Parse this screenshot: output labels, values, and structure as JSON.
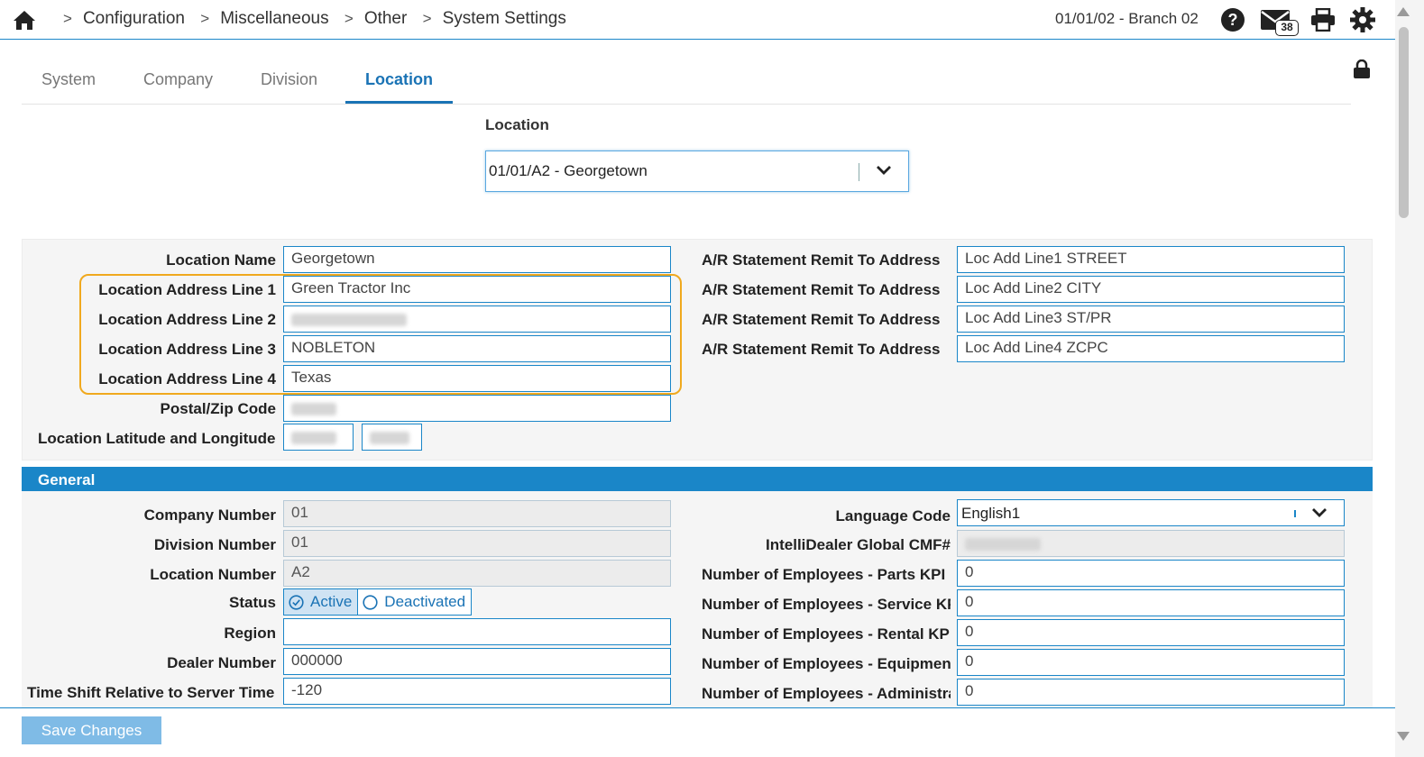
{
  "header": {
    "breadcrumbs": [
      "Configuration",
      "Miscellaneous",
      "Other",
      "System Settings"
    ],
    "breadcrumb_separator": ">",
    "branch": "01/01/02 - Branch 02",
    "mail_count": "38",
    "icons": [
      "home-icon",
      "help-icon",
      "mail-icon",
      "print-icon",
      "gear-icon"
    ]
  },
  "tabs": [
    {
      "label": "System",
      "active": false
    },
    {
      "label": "Company",
      "active": false
    },
    {
      "label": "Division",
      "active": false
    },
    {
      "label": "Location",
      "active": true
    }
  ],
  "location_select": {
    "label": "Location",
    "value": "01/01/A2 - Georgetown"
  },
  "location_form": {
    "left": [
      {
        "label": "Location Name",
        "value": "Georgetown"
      },
      {
        "label": "Location Address Line 1",
        "value": "Green Tractor Inc"
      },
      {
        "label": "Location Address Line 2",
        "value": ""
      },
      {
        "label": "Location Address Line 3",
        "value": "NOBLETON"
      },
      {
        "label": "Location Address Line 4",
        "value": "Texas"
      },
      {
        "label": "Postal/Zip Code",
        "value": ""
      },
      {
        "label": "Location Latitude and Longitude",
        "value": ""
      }
    ],
    "right": [
      {
        "label": "A/R Statement Remit To Address",
        "value": "Loc Add Line1 STREET"
      },
      {
        "label": "A/R Statement Remit To Address",
        "value": "Loc Add Line2 CITY"
      },
      {
        "label": "A/R Statement Remit To Address",
        "value": "Loc Add Line3 ST/PR"
      },
      {
        "label": "A/R Statement Remit To Address",
        "value": "Loc Add Line4 ZCPC"
      }
    ]
  },
  "general": {
    "title": "General",
    "left": [
      {
        "label": "Company Number",
        "value": "01"
      },
      {
        "label": "Division Number",
        "value": "01"
      },
      {
        "label": "Location Number",
        "value": "A2"
      },
      {
        "label": "Status",
        "value": ""
      },
      {
        "label": "Region",
        "value": ""
      },
      {
        "label": "Dealer Number",
        "value": "000000"
      },
      {
        "label": "Time Shift Relative to Server Time",
        "value": "-120"
      }
    ],
    "status_options": [
      {
        "label": "Active",
        "selected": true
      },
      {
        "label": "Deactivated",
        "selected": false
      }
    ],
    "right": [
      {
        "label": "Language Code",
        "value": "English1"
      },
      {
        "label": "IntelliDealer Global CMF#",
        "value": ""
      },
      {
        "label": "Number of Employees - Parts KPI",
        "value": "0"
      },
      {
        "label": "Number of Employees - Service KPI",
        "value": "0"
      },
      {
        "label": "Number of Employees - Rental KPI",
        "value": "0"
      },
      {
        "label": "Number of Employees - Equipment KPI",
        "value": "0"
      },
      {
        "label": "Number of Employees - Administration KPI",
        "value": "0"
      }
    ]
  },
  "footer": {
    "save_label": "Save Changes"
  },
  "colors": {
    "accent": "#1a86c8",
    "highlight": "#f0a91e",
    "save_button": "#7fbbe6"
  }
}
